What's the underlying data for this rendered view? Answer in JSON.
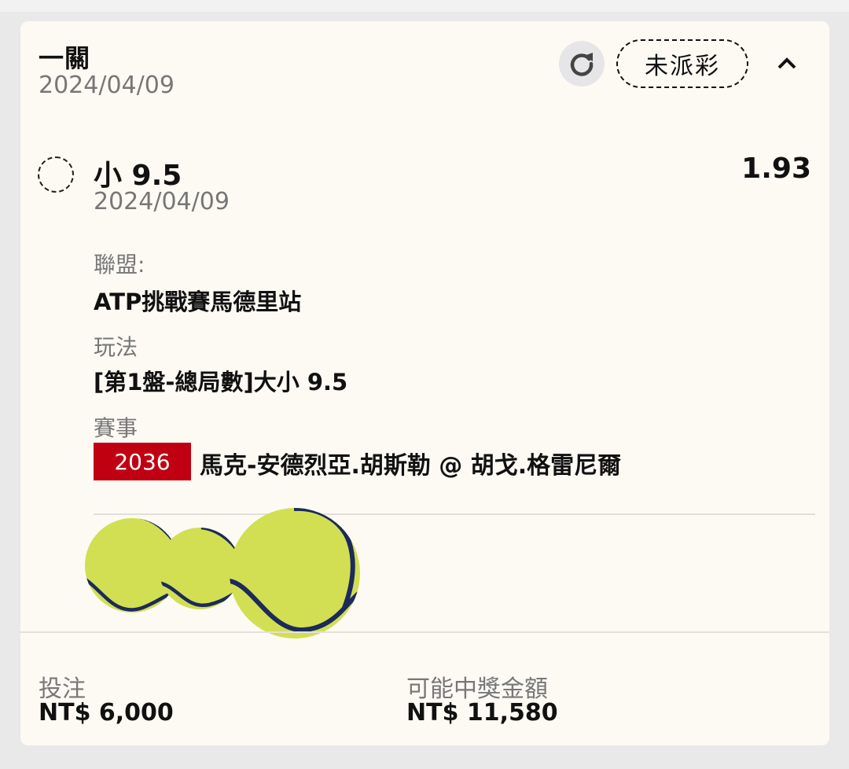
{
  "bet": {
    "type_label": "一關",
    "date": "2024/04/09",
    "status": "未派彩",
    "refresh_icon": "refresh-icon",
    "collapse_icon": "chevron-up-icon"
  },
  "selection": {
    "name": "小 9.5",
    "date": "2024/04/09",
    "odds": "1.93",
    "league_label": "聯盟:",
    "league_value": "ATP挑戰賽馬德里站",
    "market_label": "玩法",
    "market_value": "[第1盤-總局數]大小 9.5",
    "event_label": "賽事",
    "event_code": "2036",
    "event_name": "馬克-安德烈亞.胡斯勒 @ 胡戈.格雷尼爾"
  },
  "footer": {
    "stake_label": "投注",
    "stake_value": "NT$ 6,000",
    "payout_label": "可能中獎金額",
    "payout_value": "NT$ 11,580"
  },
  "colors": {
    "card_bg": "#fcfaf3",
    "page_bg": "#e9e9ea",
    "event_badge": "#c00012",
    "ball_fill": "#d2df52",
    "ball_seam": "#1c2a5c"
  }
}
